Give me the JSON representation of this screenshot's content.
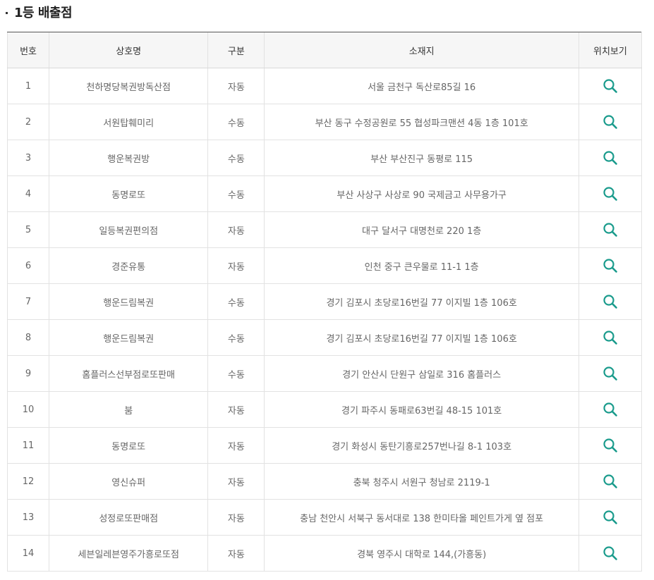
{
  "section": {
    "title": "1등 배출점"
  },
  "table": {
    "headers": {
      "no": "번호",
      "name": "상호명",
      "type": "구분",
      "address": "소재지",
      "map": "위치보기"
    },
    "icon": "search-icon",
    "accent_color": "#1a9b8c",
    "rows": [
      {
        "no": "1",
        "name": "천하명당복권방독산점",
        "type": "자동",
        "address": "서울 금천구 독산로85길 16"
      },
      {
        "no": "2",
        "name": "서원탑훼미리",
        "type": "수동",
        "address": "부산 동구 수정공원로 55 협성파크맨션 4동 1층 101호"
      },
      {
        "no": "3",
        "name": "행운복권방",
        "type": "수동",
        "address": "부산 부산진구 동평로 115"
      },
      {
        "no": "4",
        "name": "동명로또",
        "type": "수동",
        "address": "부산 사상구 사상로 90 국제금고 사무용가구"
      },
      {
        "no": "5",
        "name": "일등복권편의점",
        "type": "자동",
        "address": "대구 달서구 대명천로 220 1층"
      },
      {
        "no": "6",
        "name": "경준유통",
        "type": "자동",
        "address": "인천 중구 큰우물로 11-1 1층"
      },
      {
        "no": "7",
        "name": "행운드림복권",
        "type": "수동",
        "address": "경기 김포시 초당로16번길 77 이지빌 1층 106호"
      },
      {
        "no": "8",
        "name": "행운드림복권",
        "type": "수동",
        "address": "경기 김포시 초당로16번길 77 이지빌 1층 106호"
      },
      {
        "no": "9",
        "name": "홈플러스선부점로또판매",
        "type": "수동",
        "address": "경기 안산시 단원구 삼일로 316 홈플러스"
      },
      {
        "no": "10",
        "name": "붐",
        "type": "자동",
        "address": "경기 파주시 동패로63번길 48-15 101호"
      },
      {
        "no": "11",
        "name": "동명로또",
        "type": "자동",
        "address": "경기 화성시 동탄기흥로257번나길 8-1 103호"
      },
      {
        "no": "12",
        "name": "영신슈퍼",
        "type": "자동",
        "address": "충북 청주시 서원구 청남로 2119-1"
      },
      {
        "no": "13",
        "name": "성정로또판매점",
        "type": "자동",
        "address": "충남 천안시 서북구 동서대로 138 한미타올 페인트가게 옆 점포"
      },
      {
        "no": "14",
        "name": "세븐일레븐영주가흥로또점",
        "type": "자동",
        "address": "경북 영주시 대학로 144,(가흥동)"
      }
    ]
  }
}
